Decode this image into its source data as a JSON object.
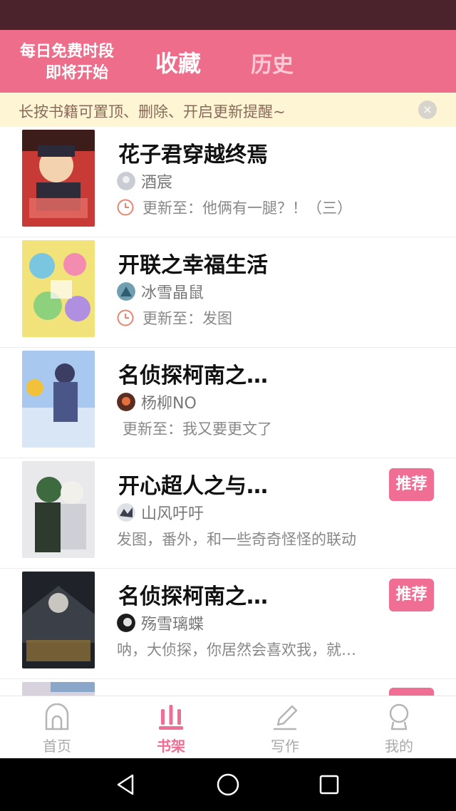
{
  "header": {
    "free_time_line1": "每日免费时段",
    "free_time_line2": "即将开始",
    "tab_favorites": "收藏",
    "tab_history": "历史"
  },
  "notice": {
    "text": "长按书籍可置顶、删除、开启更新提醒~",
    "close_icon": "×"
  },
  "books": [
    {
      "title": "花子君穿越终焉",
      "author": "酒宸",
      "update": "更新至：他俩有一腿？！（三）",
      "has_clock": true,
      "recommend": ""
    },
    {
      "title": "开联之幸福生活",
      "author": "冰雪晶鼠",
      "update": "更新至：发图",
      "has_clock": true,
      "recommend": ""
    },
    {
      "title": "名侦探柯南之…",
      "author": "杨柳NO",
      "update": "更新至：我又要更文了",
      "has_clock": false,
      "recommend": ""
    },
    {
      "title": "开心超人之与…",
      "author": "山风吁吁",
      "update": "发图，番外，和一些奇奇怪怪的联动",
      "has_clock": false,
      "recommend": "推荐"
    },
    {
      "title": "名侦探柯南之…",
      "author": "殇雪璃蝶",
      "update": "呐，大侦探，你居然会喜欢我，就…",
      "has_clock": false,
      "recommend": "推荐"
    }
  ],
  "bottom_nav": {
    "home": "首页",
    "bookshelf": "书架",
    "write": "写作",
    "mine": "我的"
  },
  "colors": {
    "accent": "#f06d93",
    "header_bg": "#ee6d8a",
    "status_bar": "#4a232c",
    "notice_bg": "#fdf5d3"
  }
}
